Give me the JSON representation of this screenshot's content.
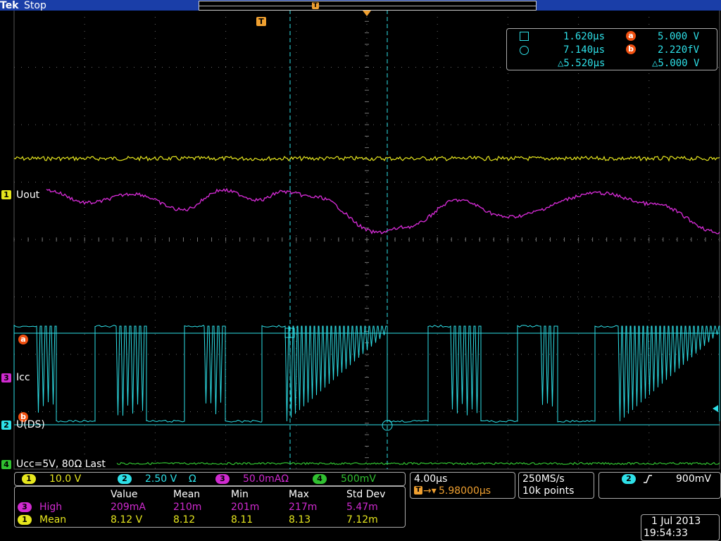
{
  "header": {
    "brand": "Tek",
    "status": "Stop"
  },
  "trigger": {
    "marker": "T",
    "level": "900mV",
    "channel": "2",
    "delay": "5.98000µs"
  },
  "cursors": {
    "t1": "1.620µs",
    "t2": "7.140µs",
    "dt": "△5.520µs",
    "a_label": "a",
    "a_val": "5.000 V",
    "b_label": "b",
    "b_val": "2.220fV",
    "dv": "△5.000 V"
  },
  "labels": {
    "ch1": "Uout",
    "ch3": "Icc",
    "ch2": "U(DS)",
    "ch4": "Ucc=5V, 80Ω Last"
  },
  "channels": [
    {
      "num": "1",
      "scale": "10.0 V",
      "color": "#e6e61e"
    },
    {
      "num": "2",
      "scale": "2.50 V",
      "unit": "Ω",
      "color": "#2ee0e8"
    },
    {
      "num": "3",
      "scale": "50.0mAΩ",
      "color": "#d02ad0"
    },
    {
      "num": "4",
      "scale": "500mV",
      "color": "#30c030"
    }
  ],
  "timebase": {
    "div": "4.00µs",
    "rate": "250MS/s",
    "points": "10k points"
  },
  "measurements": {
    "headers": [
      "Value",
      "Mean",
      "Min",
      "Max",
      "Std Dev"
    ],
    "rows": [
      {
        "ch": "3",
        "name": "High",
        "values": [
          "209mA",
          "210m",
          "201m",
          "217m",
          "5.47m"
        ]
      },
      {
        "ch": "1",
        "name": "Mean",
        "values": [
          "8.12 V",
          "8.12",
          "8.11",
          "8.13",
          "7.12m"
        ]
      }
    ]
  },
  "datetime": {
    "date": "1 Jul  2013",
    "time": "19:54:33"
  },
  "colors": {
    "ch1": "#e6e61e",
    "ch2": "#2ee0e8",
    "ch3": "#d02ad0",
    "ch4": "#30c030",
    "cursor_marker": "#f05010",
    "trigger": "#f0a030"
  }
}
